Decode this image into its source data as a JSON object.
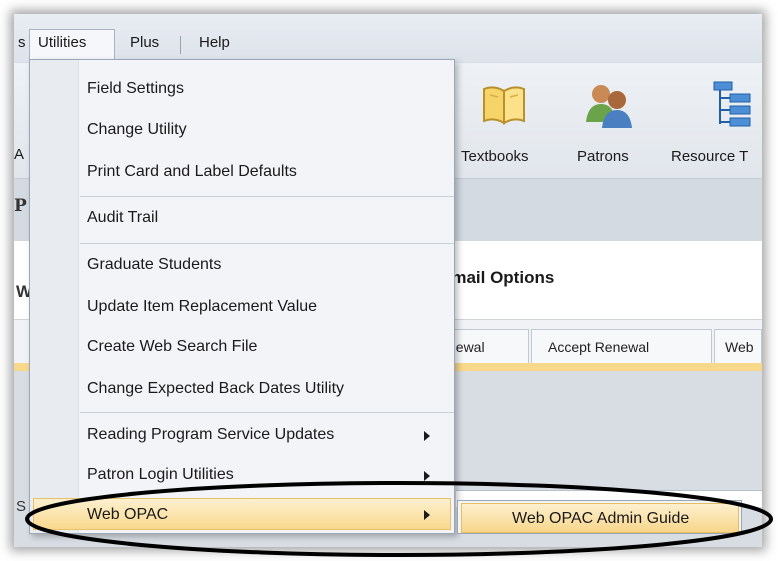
{
  "menubar": {
    "prev_fragment": "s",
    "items": [
      {
        "label": "Utilities"
      },
      {
        "label": "Plus"
      },
      {
        "label": "Help"
      }
    ]
  },
  "toolbar": {
    "left_fragment": "A",
    "buttons": [
      {
        "label": "Textbooks",
        "icon": "book-icon"
      },
      {
        "label": "Patrons",
        "icon": "people-icon"
      },
      {
        "label": "Resource T",
        "icon": "tree-icon"
      }
    ]
  },
  "content": {
    "band_fragment": "P",
    "row_fragment": "W",
    "section_title": "Email Options",
    "lower_fragment": "S",
    "tabs": [
      {
        "label": "newal"
      },
      {
        "label": "Accept Renewal"
      },
      {
        "label": "Web"
      }
    ]
  },
  "utilities_menu": {
    "items": [
      {
        "label": "Field Settings"
      },
      {
        "label": "Change Utility"
      },
      {
        "label": "Print Card and Label Defaults"
      },
      {
        "label": "Audit Trail"
      },
      {
        "label": "Graduate Students"
      },
      {
        "label": "Update Item Replacement Value"
      },
      {
        "label": "Create Web Search File"
      },
      {
        "label": "Change Expected Back Dates Utility"
      },
      {
        "label": "Reading Program Service Updates"
      },
      {
        "label": "Patron Login Utilities"
      },
      {
        "label": "Web OPAC"
      }
    ]
  },
  "web_opac_submenu": {
    "items": [
      {
        "label": "Web OPAC Admin Guide"
      }
    ]
  },
  "colors": {
    "highlight": "#f9d98e",
    "menu_bg": "#f2f4f7",
    "annotation": "#000000"
  }
}
